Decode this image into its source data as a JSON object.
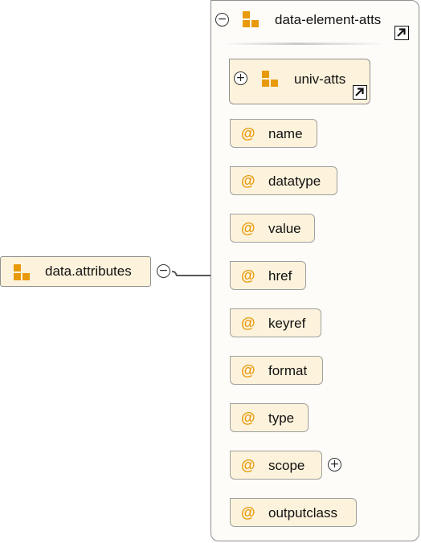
{
  "root": {
    "label": "data.attributes",
    "icon": "attribute-group-icon",
    "toggle": "−"
  },
  "group": {
    "label": "data-element-atts",
    "icon": "attribute-group-icon",
    "toggle": "−",
    "reference_icon": "reference-arrow-icon"
  },
  "univ": {
    "label": "univ-atts",
    "icon": "attribute-group-icon",
    "toggle": "+",
    "reference_icon": "reference-arrow-icon"
  },
  "attribute_symbol": "@",
  "attributes": [
    {
      "label": "name"
    },
    {
      "label": "datatype"
    },
    {
      "label": "value"
    },
    {
      "label": "href"
    },
    {
      "label": "keyref"
    },
    {
      "label": "format"
    },
    {
      "label": "type"
    },
    {
      "label": "scope",
      "toggle": "+"
    },
    {
      "label": "outputclass"
    }
  ],
  "colors": {
    "node_fill": "#fdf3dc",
    "icon_orange": "#e89a0c",
    "border": "#8f8f8f",
    "connector": "#555555"
  }
}
